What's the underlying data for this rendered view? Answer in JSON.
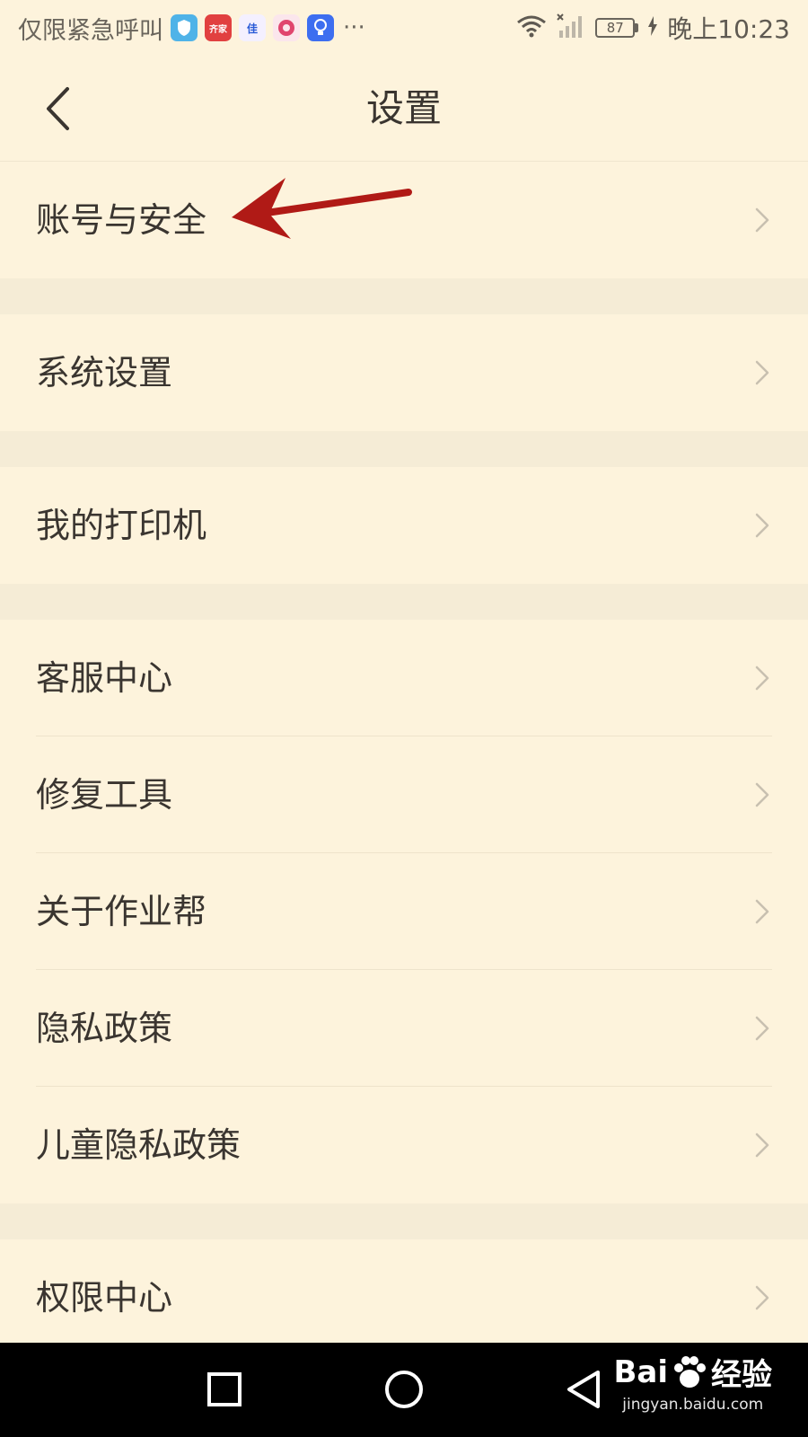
{
  "status_bar": {
    "carrier_text": "仅限紧急呼叫",
    "apps": [
      {
        "icon": "shield-icon",
        "label": ""
      },
      {
        "icon": "qijia-icon",
        "label": "齐家"
      },
      {
        "icon": "stripes-icon",
        "label": "佳"
      },
      {
        "icon": "pink-app-icon",
        "label": ""
      },
      {
        "icon": "bulb-icon",
        "label": ""
      }
    ],
    "more": "···",
    "battery_level": "87",
    "time": "晚上10:23"
  },
  "header": {
    "title": "设置"
  },
  "sections": [
    {
      "items": [
        {
          "label": "账号与安全"
        }
      ]
    },
    {
      "items": [
        {
          "label": "系统设置"
        }
      ]
    },
    {
      "items": [
        {
          "label": "我的打印机"
        }
      ]
    },
    {
      "items": [
        {
          "label": "客服中心"
        },
        {
          "label": "修复工具"
        },
        {
          "label": "关于作业帮"
        },
        {
          "label": "隐私政策"
        },
        {
          "label": "儿童隐私政策"
        }
      ]
    },
    {
      "items": [
        {
          "label": "权限中心"
        }
      ]
    }
  ],
  "watermark": {
    "brand": "Bai",
    "brand_suffix": "经验",
    "url": "jingyan.baidu.com"
  },
  "colors": {
    "background": "#fdf3dc",
    "section_gap": "#f5ecd6",
    "annotation_arrow": "#b01a16"
  }
}
